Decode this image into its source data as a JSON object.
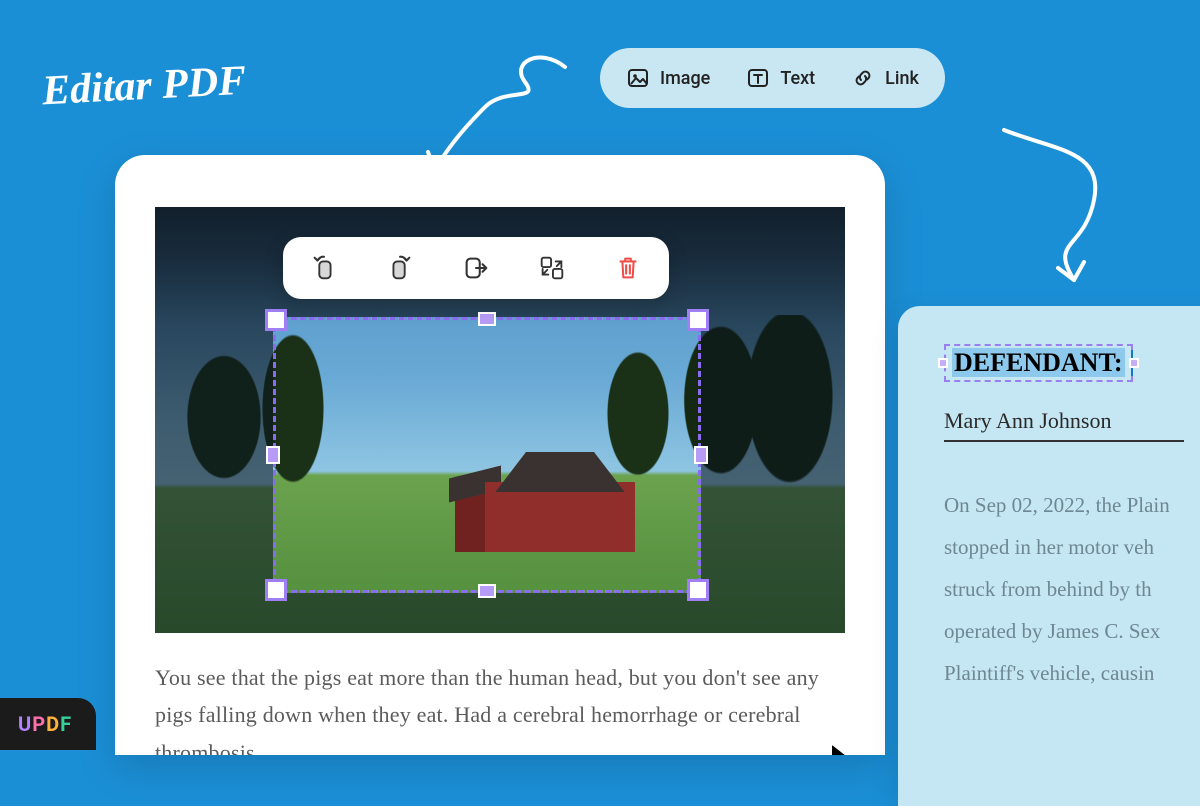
{
  "heading": "Editar PDF",
  "topToolbar": {
    "image": "Image",
    "text": "Text",
    "link": "Link"
  },
  "imageToolbar": {
    "rotateLeft": "rotate-left",
    "rotateRight": "rotate-right",
    "extract": "extract",
    "replace": "replace",
    "delete": "delete"
  },
  "editor": {
    "bodyText": "You see that the pigs eat more than the human head, but you don't see any pigs falling down when they eat. Had a cerebral hemorrhage or cerebral thrombosis"
  },
  "rightDoc": {
    "defendantLabel": "DEFENDANT:",
    "name": "Mary Ann Johnson",
    "paragraph": "On Sep 02, 2022, the Plain\nstopped in her motor veh\nstruck from behind by th\noperated by James C. Sex\nPlaintiff's vehicle, causin"
  },
  "brand": "UPDF"
}
